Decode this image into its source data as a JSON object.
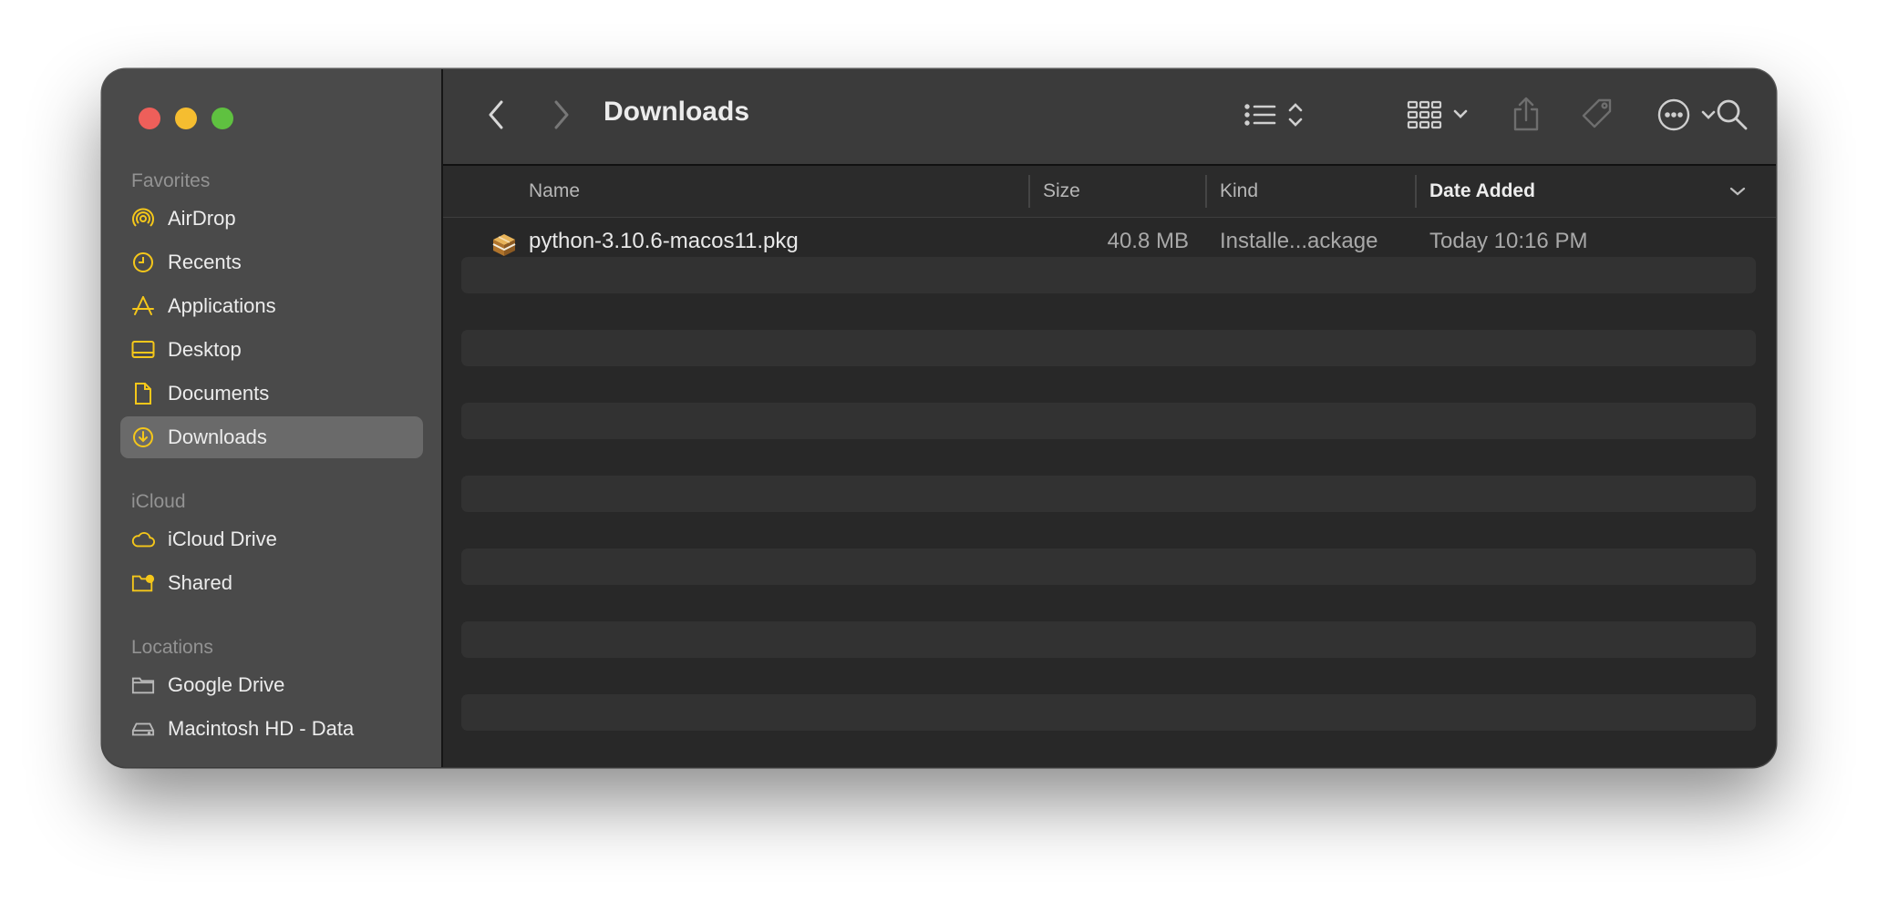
{
  "window": {
    "title": "Downloads"
  },
  "sidebar": {
    "sections": [
      {
        "title": "Favorites",
        "items": [
          {
            "label": "AirDrop",
            "icon": "airdrop-icon"
          },
          {
            "label": "Recents",
            "icon": "clock-icon"
          },
          {
            "label": "Applications",
            "icon": "applications-icon"
          },
          {
            "label": "Desktop",
            "icon": "desktop-icon"
          },
          {
            "label": "Documents",
            "icon": "document-icon"
          },
          {
            "label": "Downloads",
            "icon": "download-icon",
            "selected": true
          }
        ]
      },
      {
        "title": "iCloud",
        "items": [
          {
            "label": "iCloud Drive",
            "icon": "cloud-icon"
          },
          {
            "label": "Shared",
            "icon": "shared-folder-icon"
          }
        ]
      },
      {
        "title": "Locations",
        "items": [
          {
            "label": "Google Drive",
            "icon": "folder-icon"
          },
          {
            "label": "Macintosh HD - Data",
            "icon": "disk-icon"
          }
        ]
      }
    ]
  },
  "columns": {
    "name": "Name",
    "size": "Size",
    "kind": "Kind",
    "date_added": "Date Added"
  },
  "files": [
    {
      "name": "python-3.10.6-macos11.pkg",
      "size": "40.8 MB",
      "kind": "Installe...ackage",
      "date_added": "Today 10:16 PM",
      "icon": "package-icon"
    }
  ],
  "colors": {
    "accent_icon": "#f5c71a",
    "sidebar_bg": "#4a4a4a",
    "toolbar_bg": "#3b3b3b",
    "list_bg": "#282828"
  }
}
